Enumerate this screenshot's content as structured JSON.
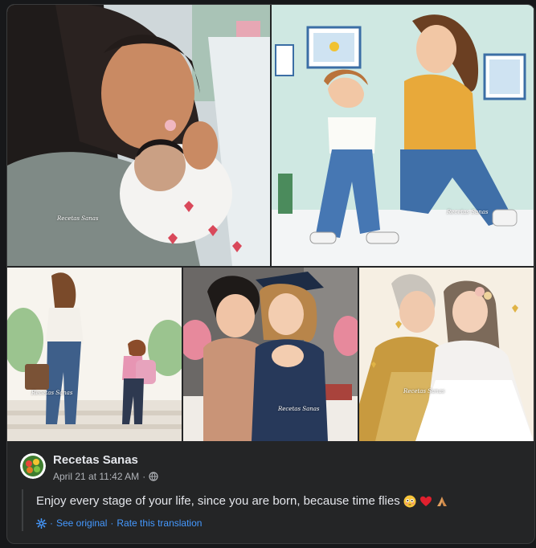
{
  "post": {
    "author": "Recetas Sanas",
    "date": "April 21 at 11:42 AM",
    "date_separator": "·",
    "text": "Enjoy every stage of your life, since you are born, because time flies",
    "emojis": [
      "flushed-face",
      "red-heart",
      "folded-hands"
    ]
  },
  "translation": {
    "separator": "·",
    "see_original": "See original",
    "rate_translation": "Rate this translation"
  },
  "watermark": {
    "brand": "Recetas Sanas"
  },
  "photos": [
    {
      "name": "mother-holding-newborn"
    },
    {
      "name": "mother-teaching-toddler-to-walk"
    },
    {
      "name": "mother-walking-child-to-school"
    },
    {
      "name": "mother-hugging-graduate"
    },
    {
      "name": "mother-hugging-bride"
    }
  ],
  "colors": {
    "background": "#17181a",
    "card": "#242526",
    "primary_text": "#e4e6eb",
    "secondary_text": "#b0b3b8",
    "link": "#4599ff"
  }
}
